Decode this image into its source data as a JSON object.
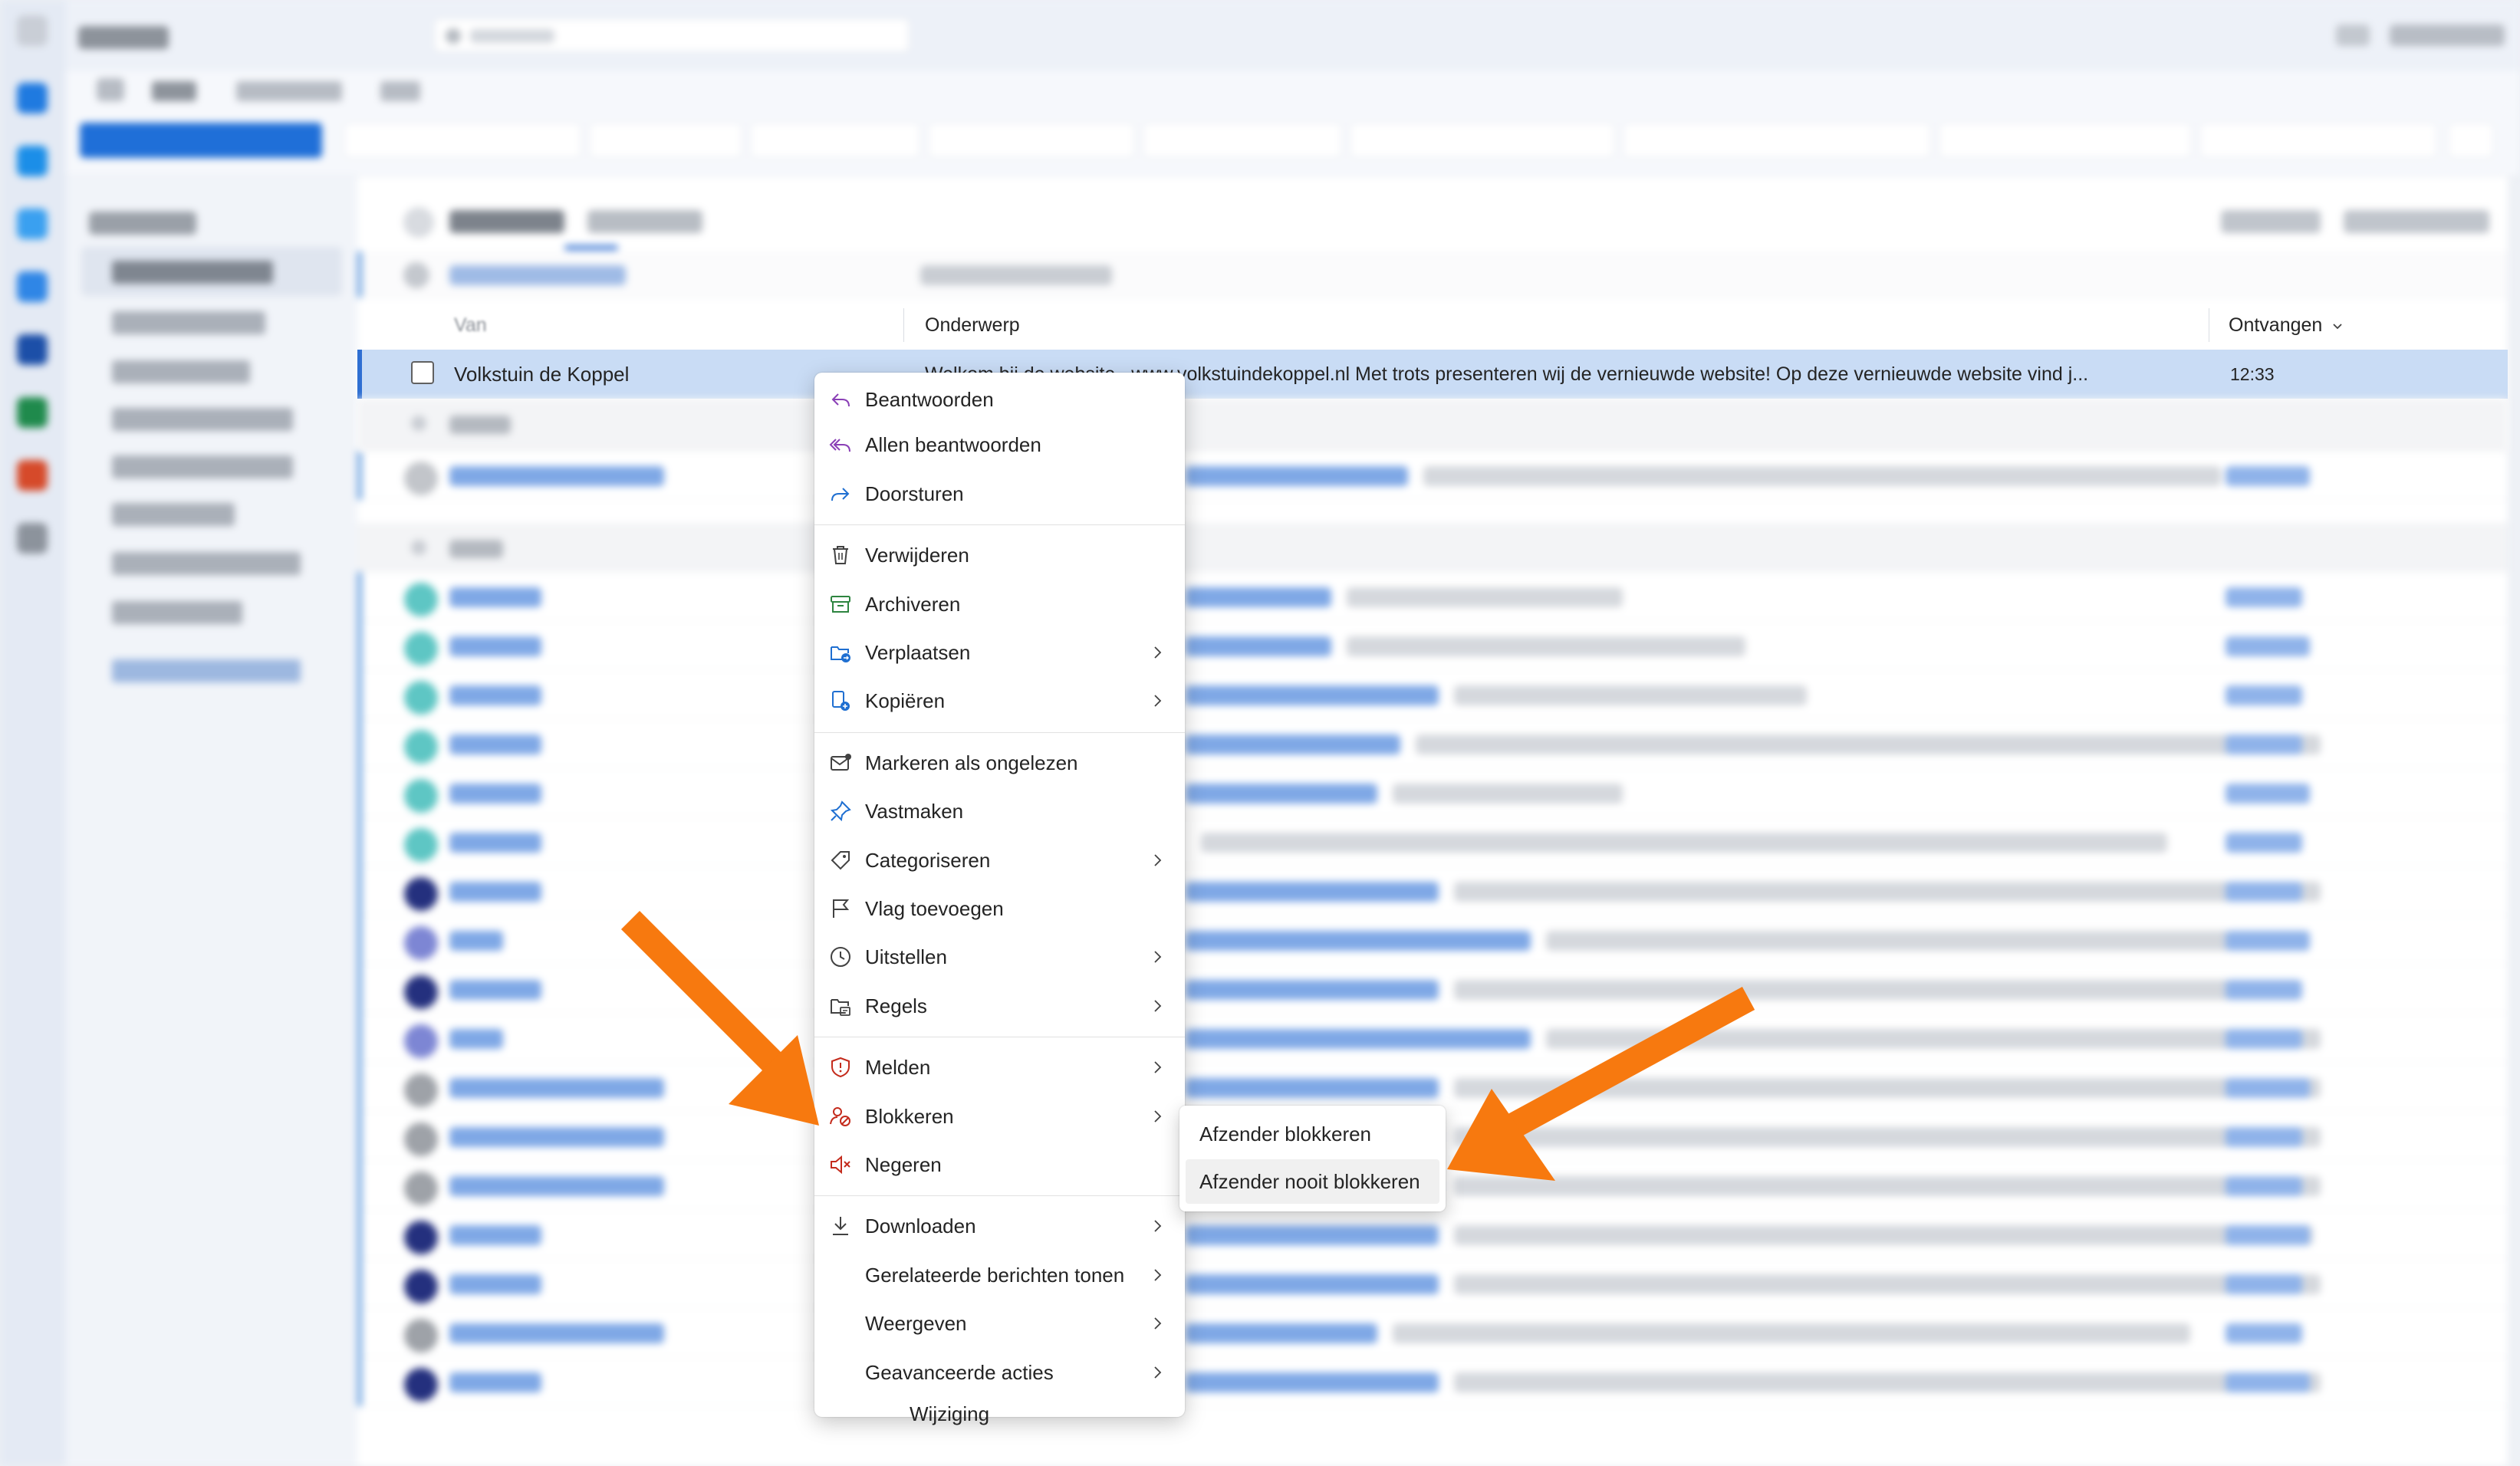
{
  "list_header": {
    "col_from": "Van",
    "col_subject": "Onderwerp",
    "col_received": "Ontvangen",
    "sort_icon": "chevron-down-icon"
  },
  "selected_message": {
    "sender": "Volkstuin de Koppel",
    "subject": "Welkom bij de website",
    "preview": "www.volkstuindekoppel.nl Met trots presenteren wij de vernieuwde website! Op deze vernieuwde website vind j...",
    "time": "12:33"
  },
  "context_menu": {
    "groups": [
      [
        {
          "label": "Beantwoorden",
          "icon": "reply-icon",
          "submenu": false
        },
        {
          "label": "Allen beantwoorden",
          "icon": "reply-all-icon",
          "submenu": false
        },
        {
          "label": "Doorsturen",
          "icon": "forward-icon",
          "submenu": false
        }
      ],
      [
        {
          "label": "Verwijderen",
          "icon": "delete-icon",
          "submenu": false
        },
        {
          "label": "Archiveren",
          "icon": "archive-icon",
          "submenu": false
        },
        {
          "label": "Verplaatsen",
          "icon": "move-icon",
          "submenu": true
        },
        {
          "label": "Kopiëren",
          "icon": "copy-icon",
          "submenu": true
        }
      ],
      [
        {
          "label": "Markeren als ongelezen",
          "icon": "mark-unread-icon",
          "submenu": false
        },
        {
          "label": "Vastmaken",
          "icon": "pin-icon",
          "submenu": false
        },
        {
          "label": "Categoriseren",
          "icon": "tag-icon",
          "submenu": true
        },
        {
          "label": "Vlag toevoegen",
          "icon": "flag-icon",
          "submenu": false
        },
        {
          "label": "Uitstellen",
          "icon": "clock-icon",
          "submenu": true
        },
        {
          "label": "Regels",
          "icon": "rules-icon",
          "submenu": true
        }
      ],
      [
        {
          "label": "Melden",
          "icon": "shield-icon",
          "submenu": true
        },
        {
          "label": "Blokkeren",
          "icon": "block-icon",
          "submenu": true
        },
        {
          "label": "Negeren",
          "icon": "mute-icon",
          "submenu": false
        }
      ],
      [
        {
          "label": "Downloaden",
          "icon": "download-icon",
          "submenu": true
        },
        {
          "label": "Gerelateerde berichten tonen",
          "icon": "",
          "submenu": true
        },
        {
          "label": "Weergeven",
          "icon": "",
          "submenu": true
        },
        {
          "label": "Geavanceerde acties",
          "icon": "",
          "submenu": true
        }
      ]
    ]
  },
  "submenu": {
    "items": [
      {
        "label": "Afzender blokkeren",
        "highlighted": false
      },
      {
        "label": "Afzender nooit blokkeren",
        "highlighted": true
      }
    ]
  },
  "under_menu_text": "Wijziging",
  "colors": {
    "accent": "#0f6cbd",
    "selection": "#c9dcf5",
    "arrow": "#f7790f",
    "menu_icon_purple": "#8a3fb6",
    "menu_icon_blue": "#1f6fd1",
    "menu_icon_green": "#2e8540",
    "menu_icon_red": "#c42b1c"
  }
}
